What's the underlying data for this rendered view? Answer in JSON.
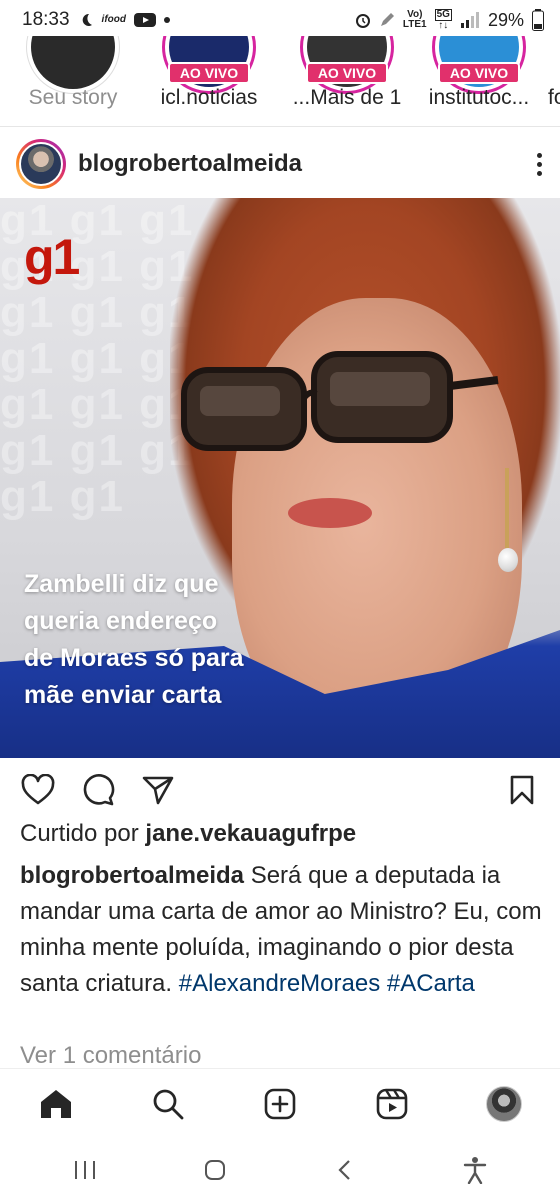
{
  "status_bar": {
    "time": "18:33",
    "notification_badges": [
      "moon",
      "ifood",
      "youtube",
      "dot"
    ],
    "network_label_top": "Vo)",
    "network_label_bottom": "LTE1",
    "network_type": "5G",
    "battery": "29%"
  },
  "stories": [
    {
      "label": "Seu story",
      "live": false
    },
    {
      "label": "icl.noticias",
      "live": true,
      "live_label": "AO VIVO"
    },
    {
      "label": "...Mais de 1",
      "live": true,
      "live_label": "AO VIVO"
    },
    {
      "label": "institutoc...",
      "live": true,
      "live_label": "AO VIVO"
    },
    {
      "label": "fo",
      "live": false
    }
  ],
  "post": {
    "username": "blogrobertoalmeida",
    "image": {
      "brand": "g1",
      "background_pattern": "g1 g1 g1 g1 g1 g1 g1 g1 g1 g1 g1 g1 g1 g1 g1 g1 g1 g1 g1 g1",
      "headline_lines": [
        "Zambelli diz que",
        "queria endereço",
        "de Moraes só para",
        "mãe enviar carta"
      ]
    },
    "liked_prefix": "Curtido por",
    "liked_by": "jane.vekauagufrpe",
    "caption_user": "blogrobertoalmeida",
    "caption_text": "Será que a deputada ia mandar uma carta de amor ao Ministro? Eu, com minha mente poluída, imaginando o pior desta santa criatura.",
    "hashtags": "#AlexandreMoraes #ACarta",
    "view_comments": "Ver 1 comentário"
  },
  "colors": {
    "live_badge": "#e1306c",
    "hashtag": "#00376b",
    "g1_red": "#c4170c",
    "muted": "#8e8e8e"
  }
}
